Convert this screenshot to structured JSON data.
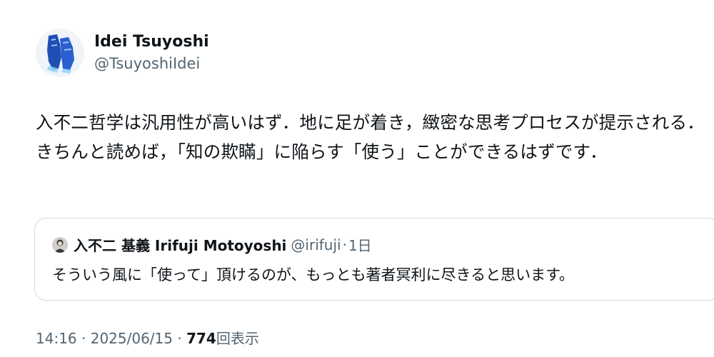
{
  "author": {
    "display_name": "Idei Tsuyoshi",
    "handle": "@TsuyoshiIdei"
  },
  "tweet": {
    "text": "入不二哲学は汎用性が高いはず．地に足が着き，緻密な思考プロセスが提示される．きちんと読めば，「知の欺瞞」に陥らす「使う」ことができるはずです．"
  },
  "quoted_tweet": {
    "display_name": "入不二 基義 Irifuji Motoyoshi",
    "handle": "@irifuji",
    "separator": "·",
    "time": "1日",
    "text": "そういう風に「使って」頂けるのが、もっとも著者冥利に尽きると思います。"
  },
  "meta": {
    "time": "14:16",
    "dot1": "·",
    "date": "2025/06/15",
    "dot2": "·",
    "views_count": "774",
    "views_label": "回表示"
  },
  "colors": {
    "primary_text": "#0f1419",
    "secondary_text": "#536471",
    "border": "#cfd9de",
    "avatar_shoe": "#1f4fb5"
  },
  "icons": {
    "author_avatar": "blue-shoes-avatar",
    "quoted_avatar": "person-avatar"
  }
}
